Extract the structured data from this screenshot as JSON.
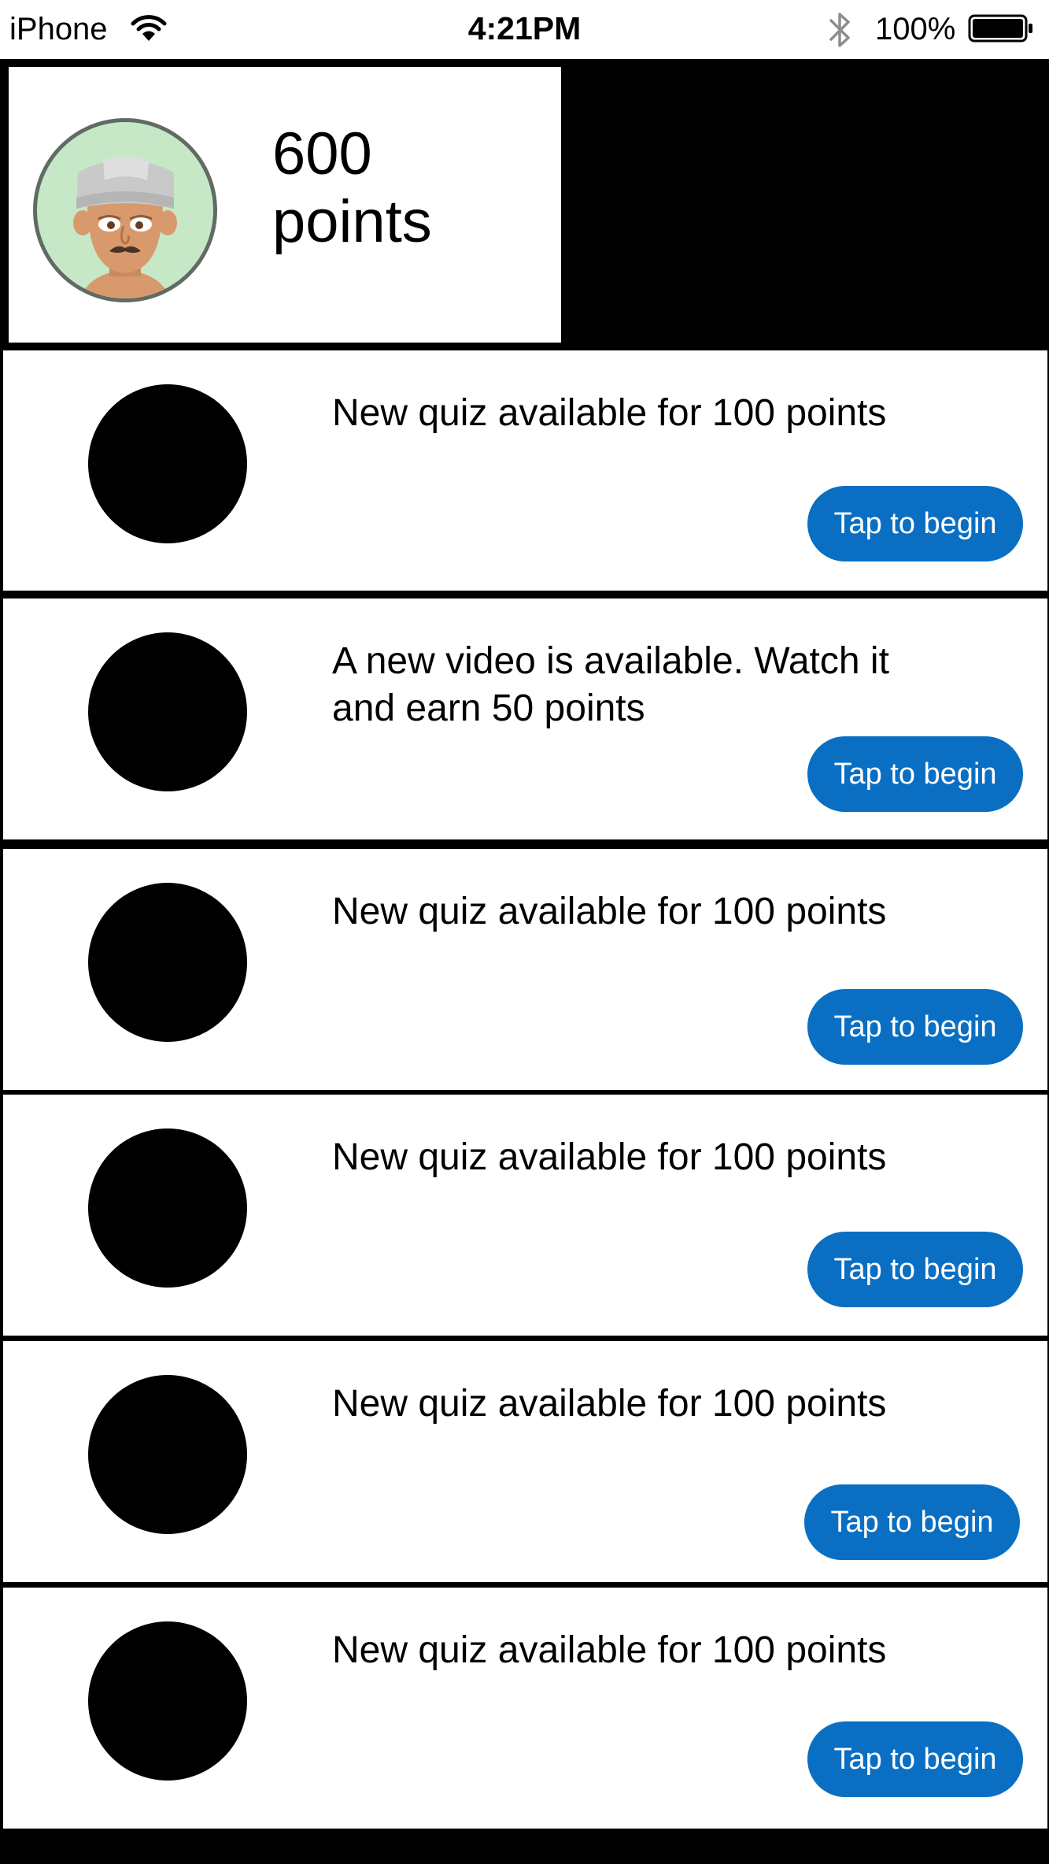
{
  "status_bar": {
    "carrier": "iPhone",
    "time": "4:21PM",
    "battery_percent": "100%",
    "icons": [
      "wifi-icon",
      "bluetooth-icon",
      "battery-icon"
    ]
  },
  "profile": {
    "avatar_icon": "avatar-cartoon-man",
    "points_value": "600",
    "points_label": "points"
  },
  "colors": {
    "button": "#0a6fc2",
    "background": "#000000",
    "card": "#ffffff"
  },
  "feed": [
    {
      "text": "New quiz available for 100 points",
      "button": "Tap to begin"
    },
    {
      "text": "A new video is available. Watch it and earn 50 points",
      "button": "Tap to begin"
    },
    {
      "text": "New quiz available for 100 points",
      "button": "Tap to begin"
    },
    {
      "text": "New quiz available for 100 points",
      "button": "Tap to begin"
    },
    {
      "text": "New quiz available for 100 points",
      "button": "Tap to begin"
    },
    {
      "text": "New quiz available for 100 points",
      "button": "Tap to begin"
    }
  ]
}
